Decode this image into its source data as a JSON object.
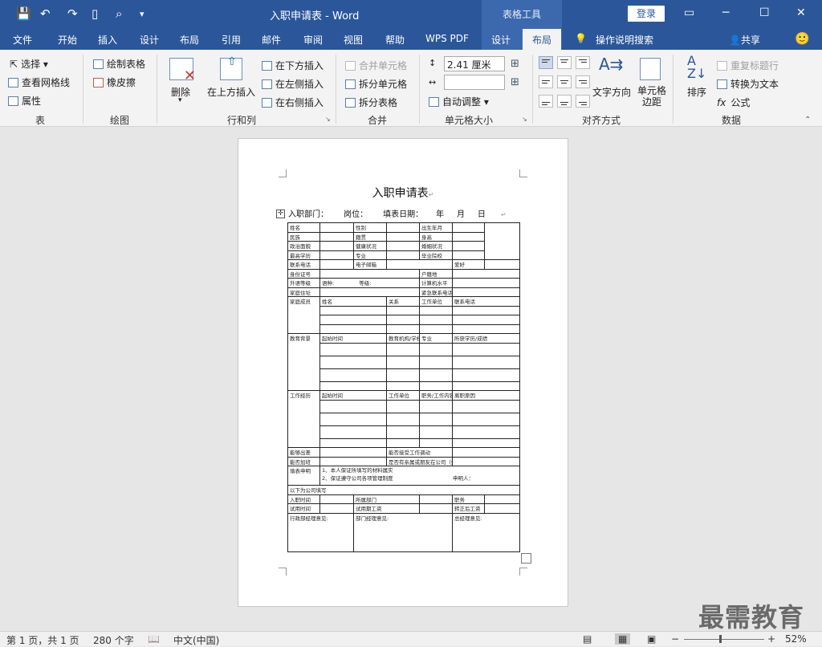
{
  "window": {
    "title": "入职申请表",
    "separator": "-",
    "app": "Word",
    "context_title": "表格工具",
    "login": "登录"
  },
  "tabs": [
    "文件",
    "开始",
    "插入",
    "设计",
    "布局",
    "引用",
    "邮件",
    "审阅",
    "视图",
    "帮助",
    "WPS PDF",
    "设计",
    "布局"
  ],
  "active_tab_index": 12,
  "search": "操作说明搜索",
  "share": "共享",
  "ribbon": {
    "table_group": {
      "select": "选择",
      "gridlines": "查看网格线",
      "props": "属性",
      "label": "表"
    },
    "draw_group": {
      "draw": "绘制表格",
      "eraser": "橡皮擦",
      "label": "绘图"
    },
    "rows_group": {
      "delete": "删除",
      "insert_above": "在上方插入",
      "insert_below": "在下方插入",
      "insert_left": "在左侧插入",
      "insert_right": "在右侧插入",
      "label": "行和列"
    },
    "merge_group": {
      "merge": "合并单元格",
      "split_cells": "拆分单元格",
      "split_table": "拆分表格",
      "label": "合并"
    },
    "size_group": {
      "height": "2.41 厘米",
      "width": "",
      "autofit": "自动调整",
      "label": "单元格大小"
    },
    "align_group": {
      "direction": "文字方向",
      "margins": "单元格边距",
      "label": "对齐方式"
    },
    "data_group": {
      "sort": "排序",
      "repeat_header": "重复标题行",
      "convert": "转换为文本",
      "formula": "公式",
      "label": "数据"
    }
  },
  "document": {
    "title": "入职申请表",
    "info": {
      "dept": "入职部门：",
      "position": "岗位：",
      "date_label": "填表日期：",
      "year": "年",
      "month": "月",
      "day": "日"
    },
    "labels": {
      "name": "姓名",
      "gender": "性别",
      "birth": "出生年月",
      "ethnic": "民族",
      "origin": "籍贯",
      "height": "身高",
      "politics": "政治面貌",
      "health": "健康状况",
      "marriage": "婚姻状况",
      "edu": "最高学历",
      "major": "专业",
      "school": "毕业院校",
      "phone": "联系电话",
      "email": "电子邮箱",
      "hobby": "爱好",
      "idno": "身份证号",
      "huji": "户籍地",
      "lang": "外语等级",
      "langtype": "语种:",
      "level": "等级:",
      "computer": "计算机水平",
      "addr": "家庭住址",
      "emergency": "紧急联系电话",
      "family": "家庭成员",
      "fam_name": "姓名",
      "fam_rel": "关系",
      "fam_work": "工作单位",
      "fam_tel": "联系电话",
      "eduback": "教育背景",
      "start": "起始时间",
      "inst": "教育机构/学校",
      "major2": "专业",
      "degree": "所获学历/成绩",
      "work": "工作经历",
      "work_start": "起始时间",
      "work_unit": "工作单位",
      "work_job": "职务/工作内容",
      "work_leave": "离职原因",
      "travel": "能够出差",
      "transfer": "能否接受工作调动",
      "overtime": "能否加班",
      "relative": "是否有亲属或朋友在公司（姓名）",
      "declare": "填表申明",
      "declare1": "1、本人保证所填写的材料属实",
      "declare2": "2、保证遵守公司各项管理制度",
      "applicant": "申明人：",
      "company": "以下为公司填写",
      "entry": "入职时间",
      "dept": "所属部门",
      "duty": "职务",
      "trial": "试用时间",
      "trial_salary": "试用期工资",
      "regular_salary": "转正后工资",
      "admin": "行政部经理意见:",
      "mgr": "部门经理意见:",
      "gm": "总经理意见:"
    }
  },
  "status": {
    "page": "第 1 页，共 1 页",
    "words": "280 个字",
    "lang": "中文(中国)",
    "zoom": "52%"
  },
  "watermark": "最需教育"
}
